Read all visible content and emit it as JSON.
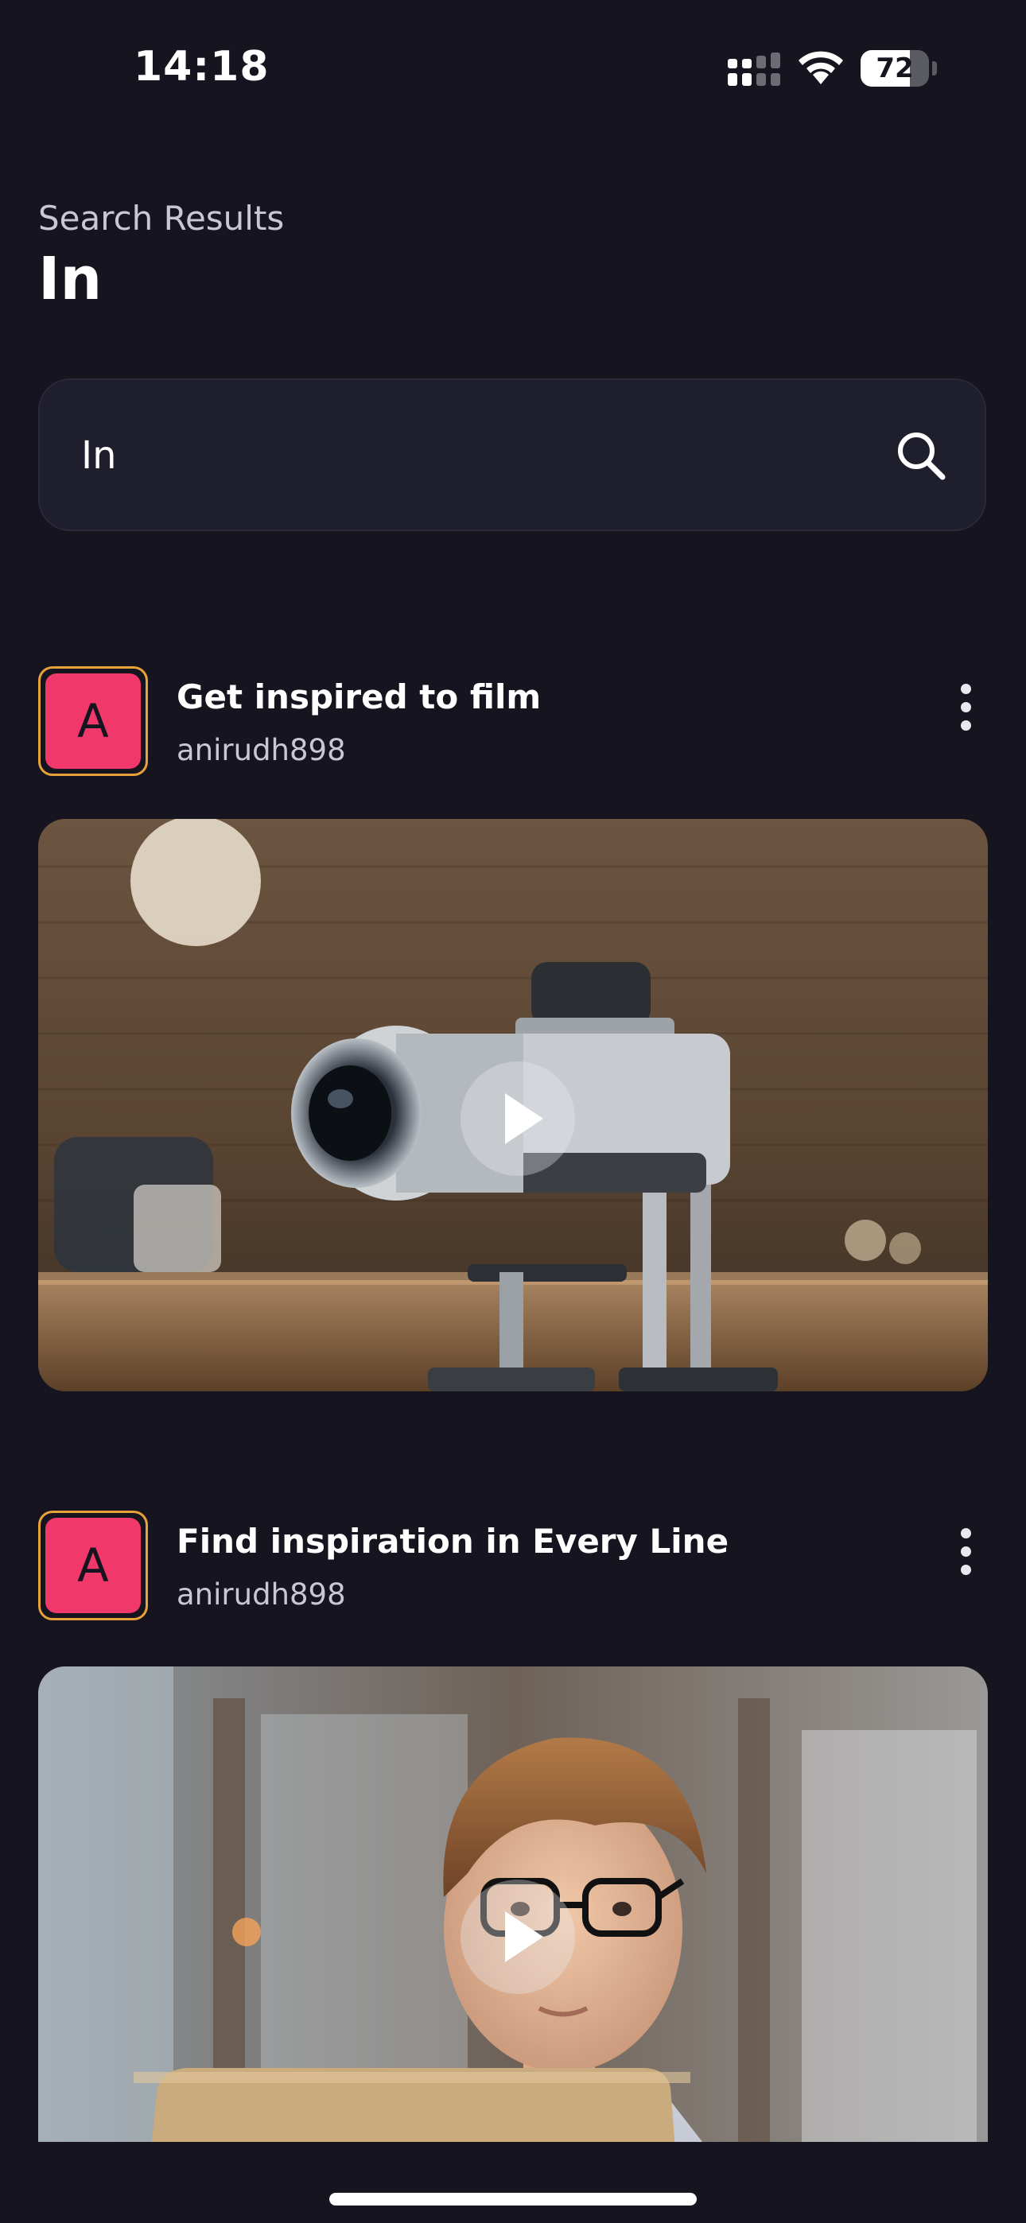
{
  "status_bar": {
    "time": "14:18",
    "battery_level": "72",
    "battery_fraction": 0.72
  },
  "header": {
    "subtitle": "Search Results",
    "title": "In"
  },
  "search": {
    "value": "In",
    "icon": "search-icon"
  },
  "posts": [
    {
      "avatar_letter": "A",
      "title": "Get inspired to film",
      "author": "anirudh898",
      "media": "camera on tripod video thumbnail"
    },
    {
      "avatar_letter": "A",
      "title": "Find inspiration in Every Line",
      "author": "anirudh898",
      "media": "boy with glasses at laptop video thumbnail"
    }
  ],
  "colors": {
    "background": "#15141f",
    "search_bg": "#1f1e2c",
    "avatar_fill": "#f0386b",
    "avatar_border": "#e8a23a",
    "subtitle_text": "#c9c7d6"
  }
}
